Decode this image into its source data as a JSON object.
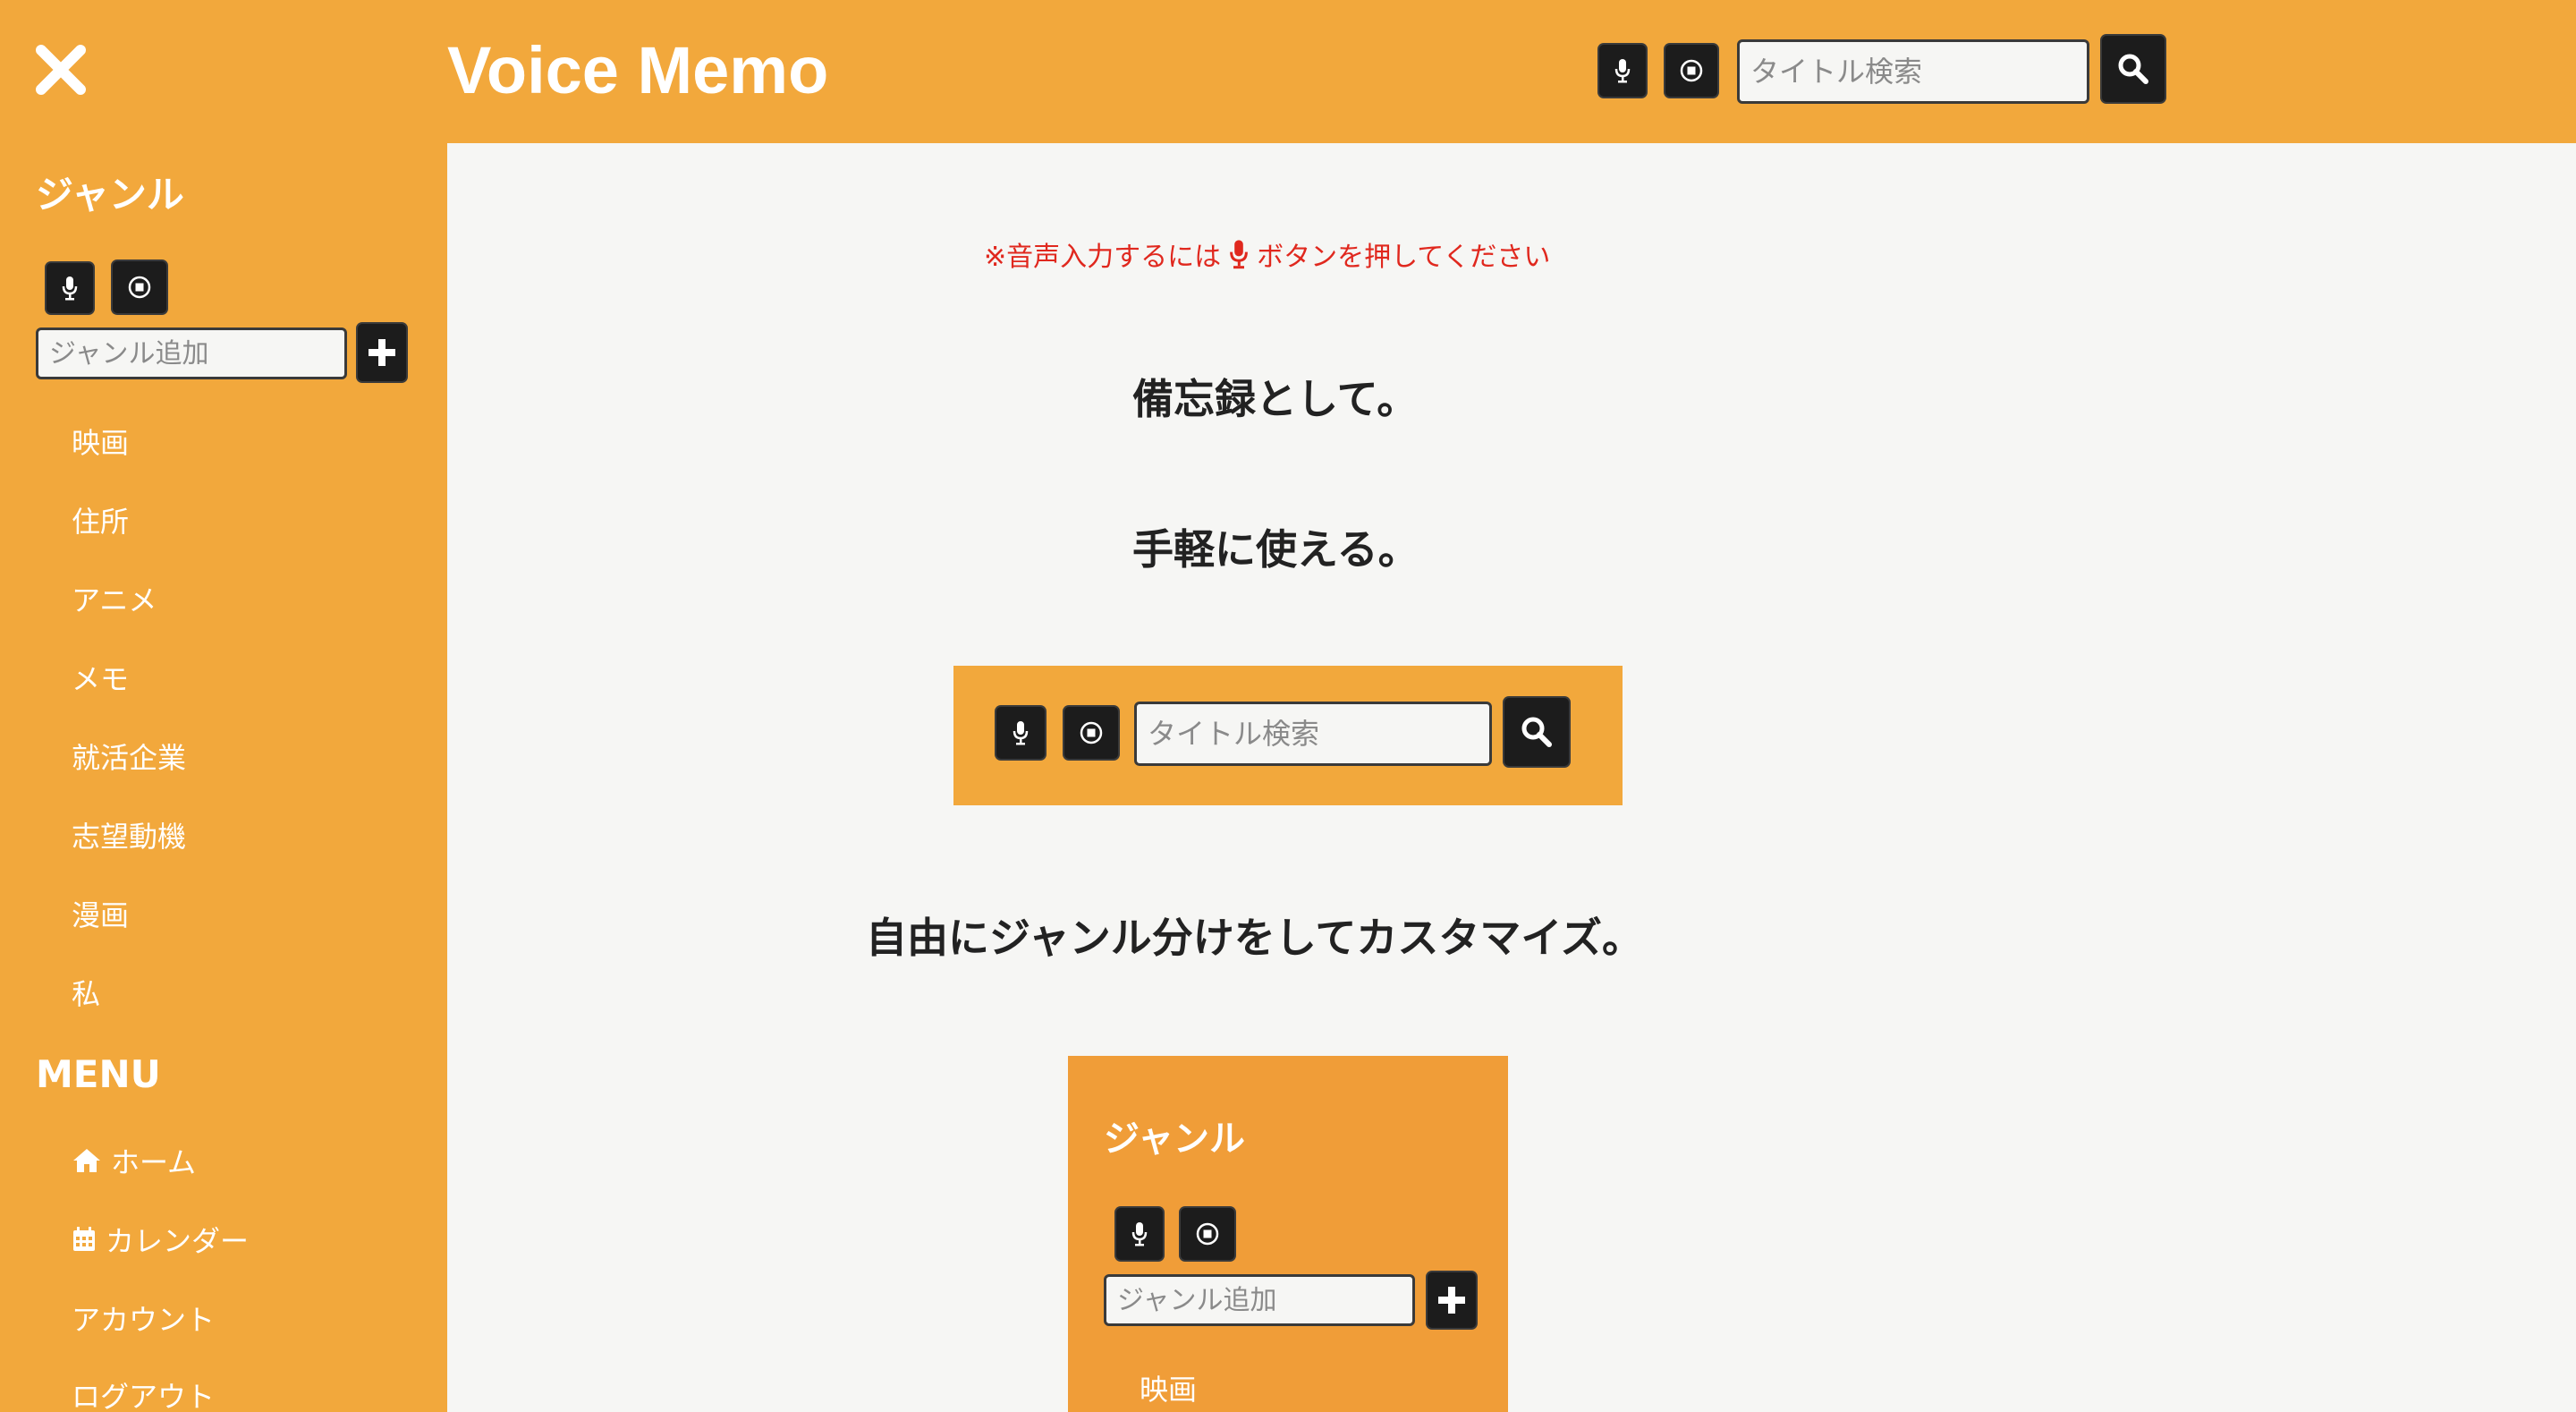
{
  "header": {
    "app_title": "Voice Memo",
    "search_placeholder": "タイトル検索"
  },
  "sidebar": {
    "genre_title": "ジャンル",
    "genre_add_placeholder": "ジャンル追加",
    "genres": [
      "映画",
      "住所",
      "アニメ",
      "メモ",
      "就活企業",
      "志望動機",
      "漫画",
      "私"
    ],
    "menu_title": "MENU",
    "menu_items": [
      {
        "label": "ホーム",
        "icon": "home-icon"
      },
      {
        "label": "カレンダー",
        "icon": "calendar-icon"
      },
      {
        "label": "アカウント",
        "icon": ""
      },
      {
        "label": "ログアウト",
        "icon": ""
      }
    ]
  },
  "main": {
    "notice_prefix": "※音声入力するには",
    "notice_suffix": "ボタンを押してください",
    "headline_1": "備忘録として。",
    "headline_2": "手軽に使える。",
    "headline_3": "自由にジャンル分けをしてカスタマイズ。",
    "demo_search_placeholder": "タイトル検索",
    "demo_genre_title": "ジャンル",
    "demo_genre_placeholder": "ジャンル追加",
    "demo_genre_first": "映画"
  },
  "colors": {
    "accent": "#f2a83c",
    "notice": "#e0281e",
    "background": "#f6f6f4",
    "button": "#1c1c1c"
  }
}
